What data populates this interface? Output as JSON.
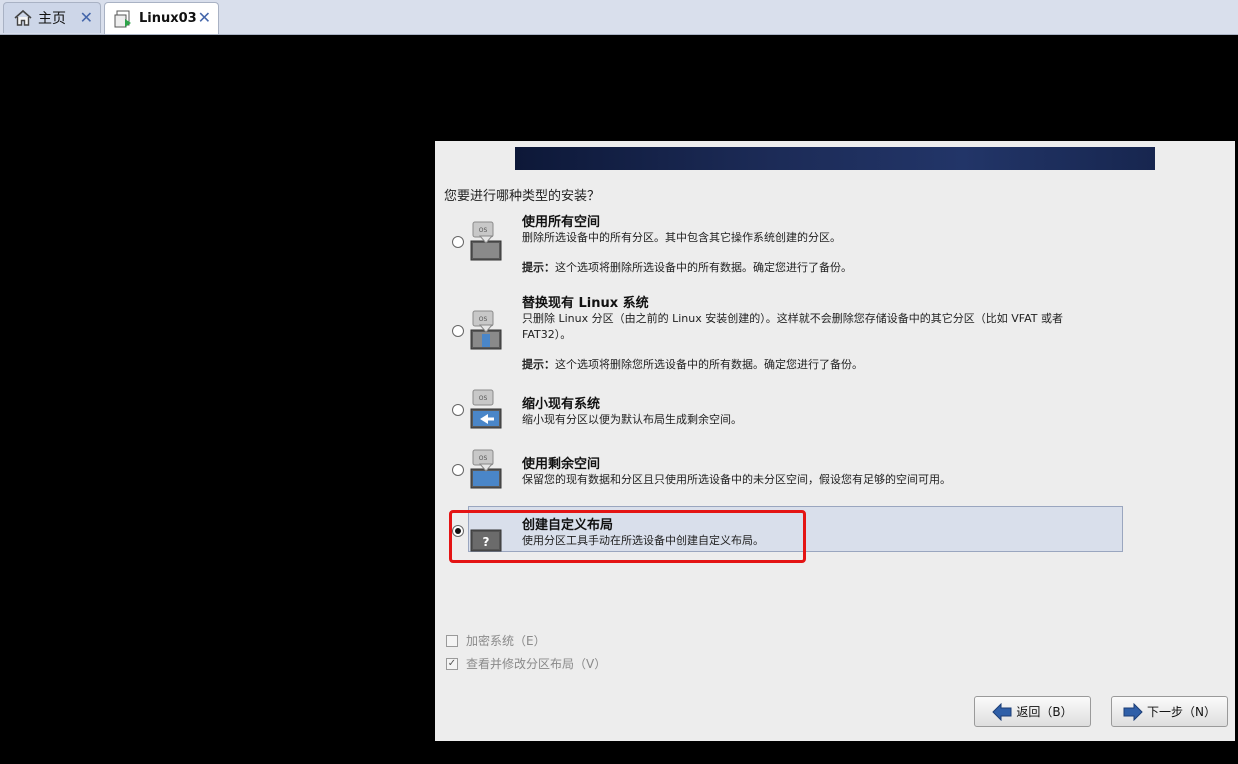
{
  "tabs": [
    {
      "label": "主页",
      "icon": "home-icon",
      "close": "✕"
    },
    {
      "label": "Linux03",
      "icon": "vm-icon",
      "close": "✕"
    }
  ],
  "installer": {
    "question": "您要进行哪种类型的安装？",
    "options": [
      {
        "title": "使用所有空间",
        "desc": "删除所选设备中的所有分区。其中包含其它操作系统创建的分区。",
        "hint_label": "提示：",
        "hint": "这个选项将删除所选设备中的所有数据。确定您进行了备份。",
        "icon": "drive-wipe-icon",
        "selected": false
      },
      {
        "title": "替换现有 Linux 系统",
        "desc": "只删除 Linux 分区（由之前的 Linux 安装创建的）。这样就不会删除您存储设备中的其它分区（比如 VFAT 或者 FAT32）。",
        "hint_label": "提示：",
        "hint": "这个选项将删除您所选设备中的所有数据。确定您进行了备份。",
        "icon": "drive-replace-icon",
        "selected": false
      },
      {
        "title": "缩小现有系统",
        "desc": "缩小现有分区以便为默认布局生成剩余空间。",
        "icon": "drive-shrink-icon",
        "selected": false
      },
      {
        "title": "使用剩余空间",
        "desc": "保留您的现有数据和分区且只使用所选设备中的未分区空间，假设您有足够的空间可用。",
        "icon": "drive-free-space-icon",
        "selected": false
      },
      {
        "title": "创建自定义布局",
        "desc": "使用分区工具手动在所选设备中创建自定义布局。",
        "icon": "question-drive-icon",
        "selected": true
      }
    ],
    "os_label": "OS",
    "question_mark": "?",
    "encrypt": {
      "label": "加密系统（E）",
      "checked": false
    },
    "review": {
      "label": "查看并修改分区布局（V）",
      "checked": true
    },
    "back_button": "返回（B）",
    "next_button": "下一步（N）"
  }
}
